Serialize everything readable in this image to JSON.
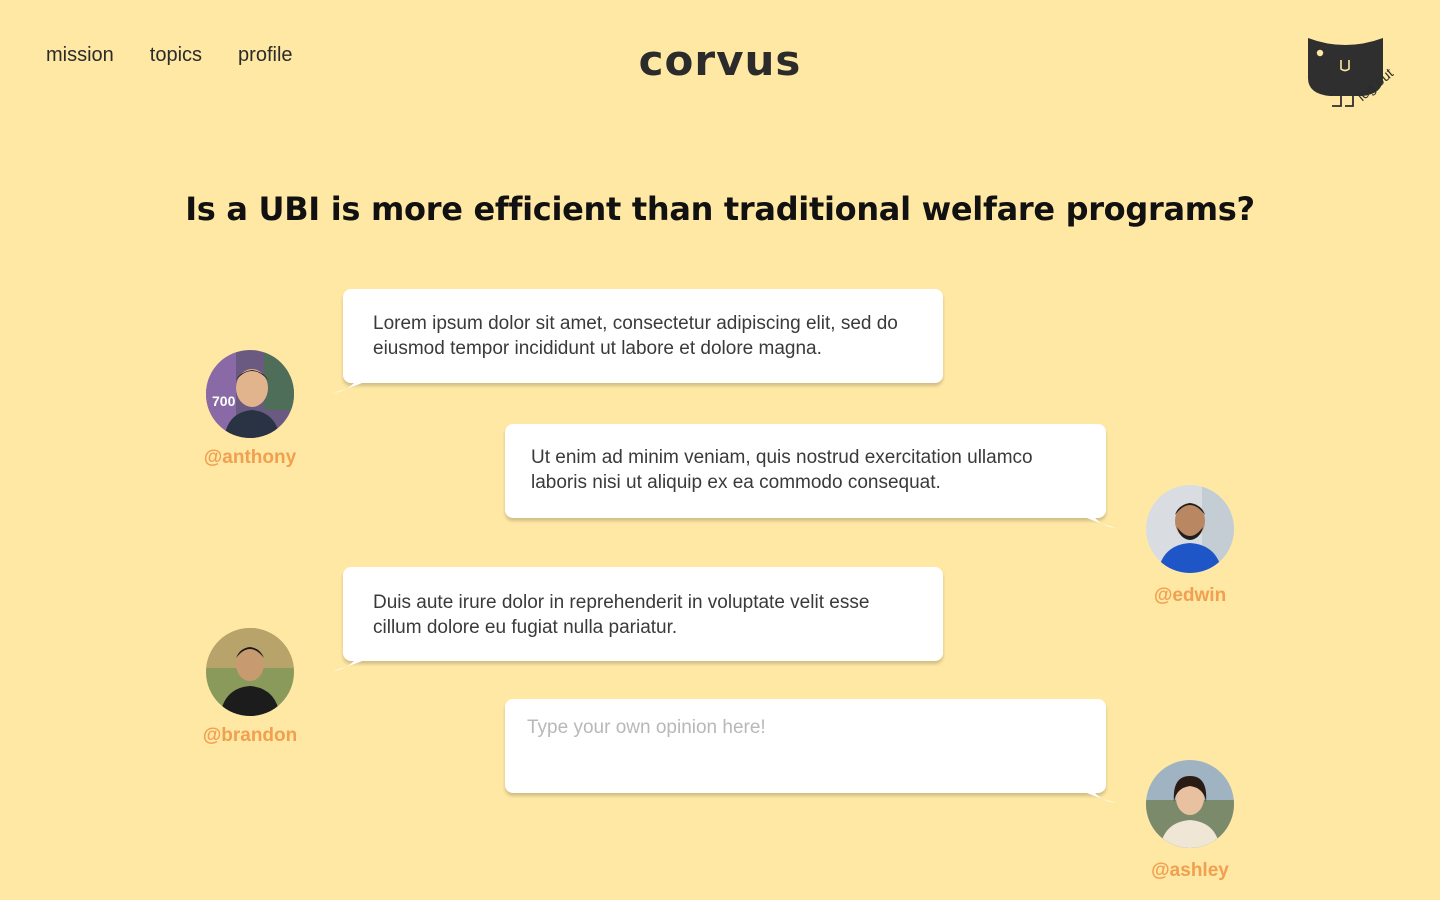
{
  "nav": {
    "mission": "mission",
    "topics": "topics",
    "profile": "profile"
  },
  "brand": {
    "name": "corvus"
  },
  "account": {
    "logout": "log out"
  },
  "topic": {
    "question": "Is a UBI is more efficient than traditional welfare programs?"
  },
  "messages": [
    {
      "handle": "@anthony",
      "text": "Lorem ipsum dolor sit amet, consectetur adipiscing elit, sed do eiusmod tempor incididunt ut labore et dolore magna."
    },
    {
      "handle": "@edwin",
      "text": "Ut enim ad minim veniam, quis nostrud exercitation ullamco laboris nisi ut aliquip ex ea commodo consequat."
    },
    {
      "handle": "@brandon",
      "text": "Duis aute irure dolor in reprehenderit in voluptate velit esse cillum dolore eu fugiat nulla pariatur."
    }
  ],
  "composer": {
    "handle": "@ashley",
    "placeholder": "Type your own opinion here!"
  },
  "colors": {
    "background": "#FFE8A3",
    "handle": "#F0A050",
    "bubble": "#FFFFFF",
    "ink": "#2B2B2B"
  },
  "icons": {
    "mascot": "crow-mascot-icon"
  }
}
